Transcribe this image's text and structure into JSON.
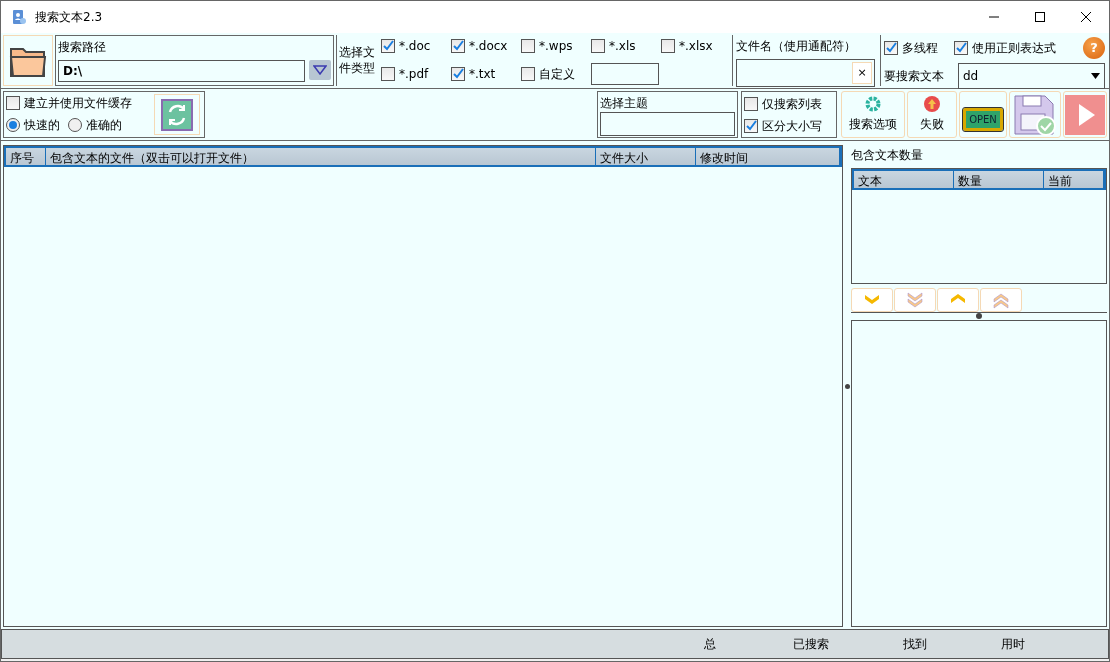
{
  "window": {
    "title": "搜索文本2.3"
  },
  "search_path": {
    "label": "搜索路径",
    "value": "D:\\"
  },
  "file_types": {
    "label": "选择文件类型",
    "options": [
      {
        "label": "*.doc",
        "checked": true
      },
      {
        "label": "*.docx",
        "checked": true
      },
      {
        "label": "*.wps",
        "checked": false
      },
      {
        "label": "*.xls",
        "checked": false
      },
      {
        "label": "*.xlsx",
        "checked": false
      },
      {
        "label": "*.pdf",
        "checked": false
      },
      {
        "label": "*.txt",
        "checked": true
      },
      {
        "label": "自定义",
        "checked": false
      }
    ]
  },
  "filename": {
    "label": "文件名（使用通配符）",
    "clear": "×"
  },
  "options": [
    {
      "label": "多线程",
      "checked": true
    },
    {
      "label": "使用正则表达式",
      "checked": true
    }
  ],
  "help": "?",
  "search_text": {
    "label": "要搜索文本",
    "value": "dd"
  },
  "cache": {
    "label": "建立并使用文件缓存",
    "checked": false,
    "modes": [
      {
        "label": "快速的",
        "selected": true
      },
      {
        "label": "准确的",
        "selected": false
      }
    ]
  },
  "theme": {
    "label": "选择主题"
  },
  "search_flags": [
    {
      "label": "仅搜索列表",
      "checked": false
    },
    {
      "label": "区分大小写",
      "checked": true
    }
  ],
  "toolbar": [
    {
      "kind": "gear",
      "label": "搜索选项"
    },
    {
      "kind": "fail",
      "label": "失败"
    },
    {
      "kind": "open",
      "label": "OPEN"
    },
    {
      "kind": "save"
    },
    {
      "kind": "play"
    }
  ],
  "results_table": {
    "columns": [
      "序号",
      "包含文本的文件（双击可以打开文件）",
      "文件大小",
      "修改时间"
    ]
  },
  "count_panel": {
    "title": "包含文本数量",
    "columns": [
      "文本",
      "数量",
      "当前"
    ]
  },
  "nav_buttons": [
    {
      "kind": "down"
    },
    {
      "kind": "double-down"
    },
    {
      "kind": "up"
    },
    {
      "kind": "double-up"
    }
  ],
  "status_bar": [
    "总",
    "已搜索",
    "找到",
    "用时"
  ]
}
